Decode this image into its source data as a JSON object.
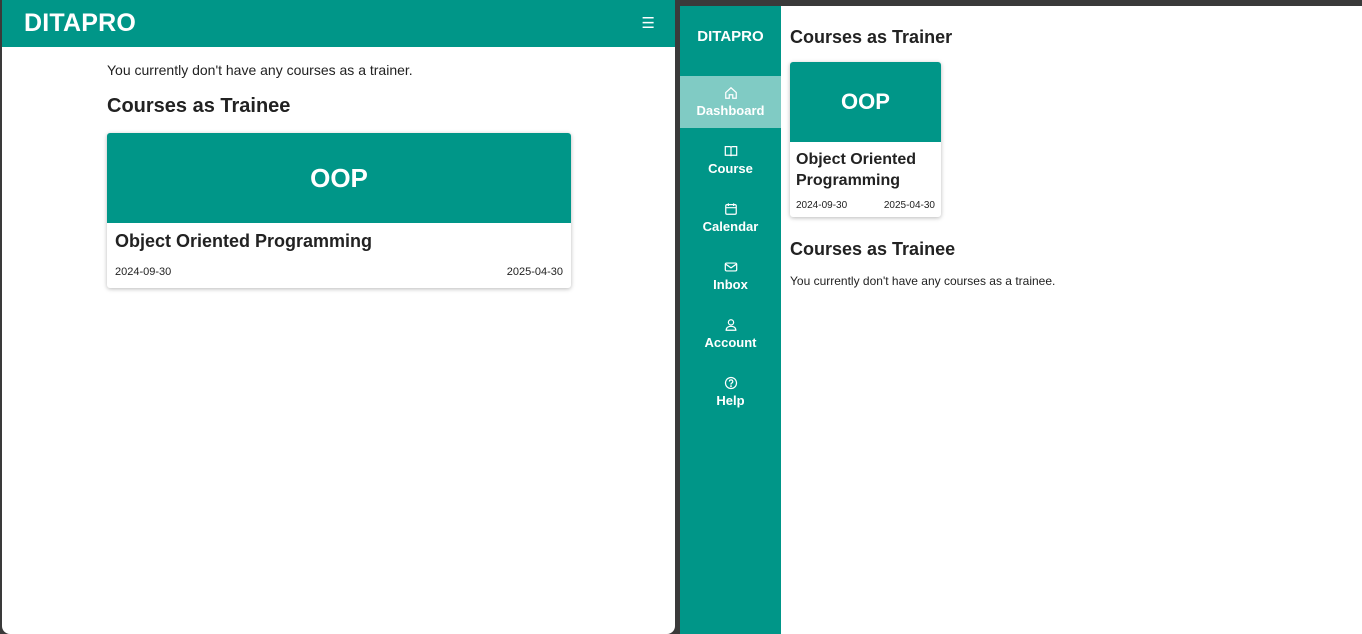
{
  "mobile": {
    "brand": "DITAPRO",
    "menu_icon": "hamburger-icon",
    "trainer_empty_text": "You currently don't have any courses as a trainer.",
    "trainee_title": "Courses as Trainee",
    "trainee_courses": [
      {
        "code": "OOP",
        "name": "Object Oriented Programming",
        "start": "2024-09-30",
        "end": "2025-04-30"
      }
    ]
  },
  "desktop": {
    "brand": "DITAPRO",
    "nav": [
      {
        "label": "Dashboard",
        "icon": "home-icon",
        "active": true
      },
      {
        "label": "Course",
        "icon": "book-icon",
        "active": false
      },
      {
        "label": "Calendar",
        "icon": "calendar-icon",
        "active": false
      },
      {
        "label": "Inbox",
        "icon": "mail-icon",
        "active": false
      },
      {
        "label": "Account",
        "icon": "user-icon",
        "active": false
      },
      {
        "label": "Help",
        "icon": "help-icon",
        "active": false
      }
    ],
    "trainer_title": "Courses as Trainer",
    "trainer_courses": [
      {
        "code": "OOP",
        "name": "Object Oriented Programming",
        "start": "2024-09-30",
        "end": "2025-04-30"
      }
    ],
    "trainee_title": "Courses as Trainee",
    "trainee_empty_text": "You currently don't have any courses as a trainee."
  },
  "colors": {
    "accent": "#009688",
    "active_nav": "#80cbc4"
  }
}
